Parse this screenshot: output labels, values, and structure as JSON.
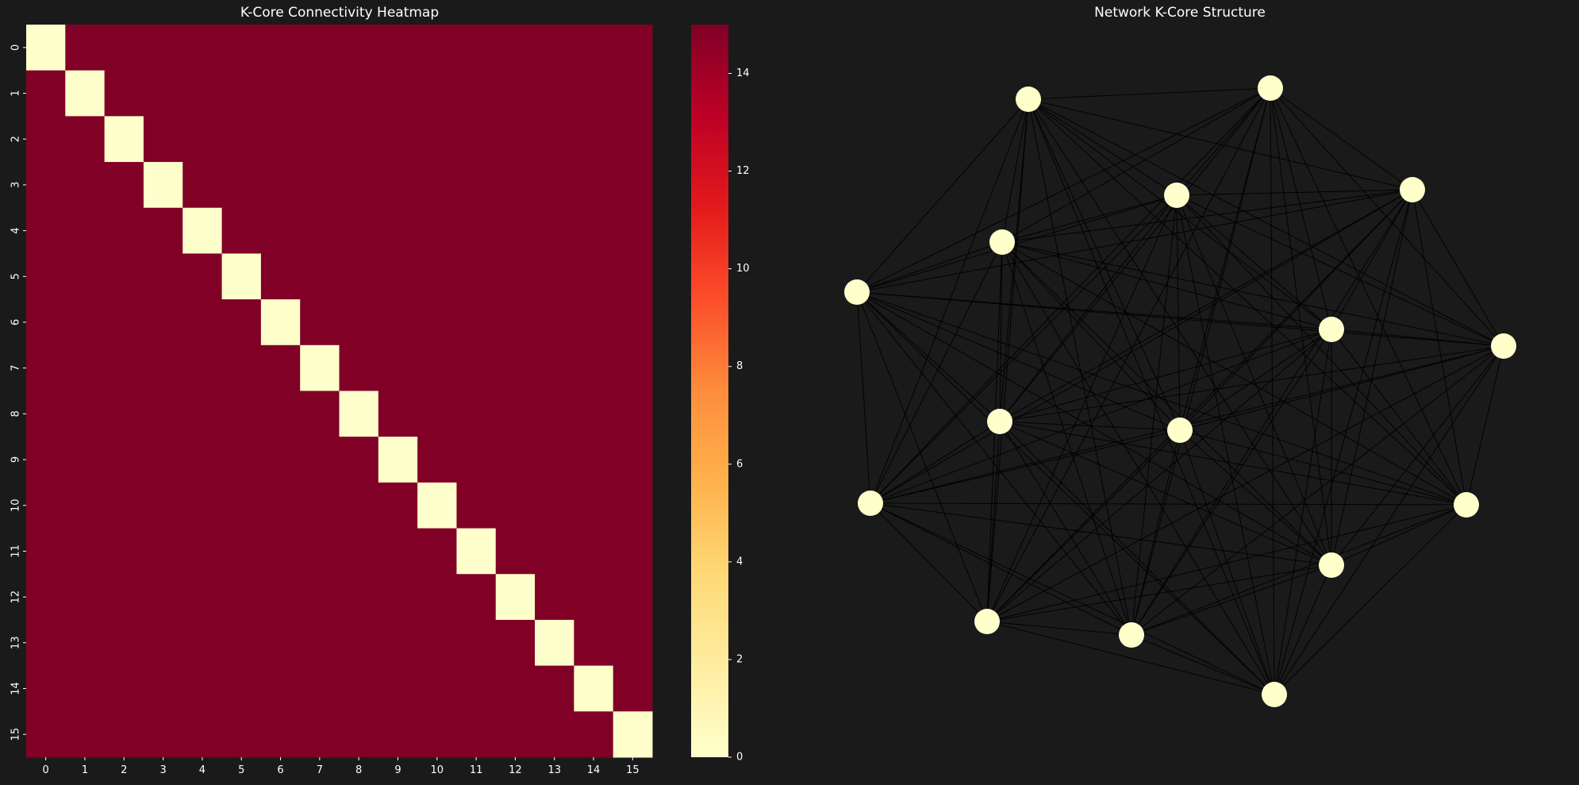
{
  "panels": {
    "heatmap_title": "K-Core Connectivity Heatmap",
    "network_title": "Network K-Core Structure"
  },
  "chart_data": [
    {
      "type": "heatmap",
      "title": "K-Core Connectivity Heatmap",
      "row_labels": [
        "0",
        "1",
        "2",
        "3",
        "4",
        "5",
        "6",
        "7",
        "8",
        "9",
        "10",
        "11",
        "12",
        "13",
        "14",
        "15"
      ],
      "col_labels": [
        "0",
        "1",
        "2",
        "3",
        "4",
        "5",
        "6",
        "7",
        "8",
        "9",
        "10",
        "11",
        "12",
        "13",
        "14",
        "15"
      ],
      "values_rule": "diagonal = 0, off-diagonal = 15",
      "diagonal_value": 0,
      "offdiagonal_value": 15,
      "colormap": "YlOrRd",
      "colorbar_range": [
        0,
        15
      ],
      "colorbar_ticks": [
        "0",
        "2",
        "4",
        "6",
        "8",
        "10",
        "12",
        "14"
      ],
      "colors": {
        "low": "#ffffcc",
        "high": "#800026"
      }
    },
    {
      "type": "network",
      "title": "Network K-Core Structure",
      "node_count": 16,
      "edges": "complete graph (every node connected to every other node)",
      "node_color": "#ffffcc",
      "edge_color": "#000000"
    }
  ]
}
